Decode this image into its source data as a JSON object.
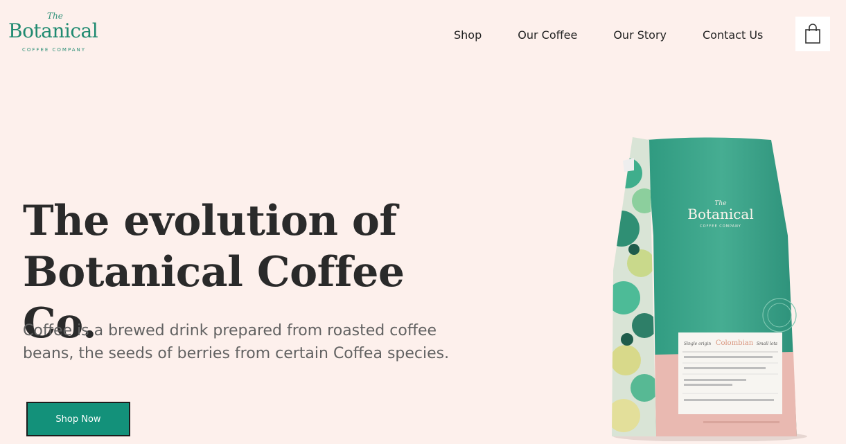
{
  "brand": {
    "the": "The",
    "name": "Botanical",
    "sub": "COFFEE COMPANY"
  },
  "nav": {
    "items": [
      "Shop",
      "Our Coffee",
      "Our Story",
      "Contact Us"
    ]
  },
  "cart": {
    "icon": "shopping-bag-icon"
  },
  "hero": {
    "title_line1": "The evolution of",
    "title_line2": "Botanical Coffee Co.",
    "description": "Coffee is a brewed drink prepared from roasted coffee beans, the seeds of berries from certain Coffea species.",
    "cta_label": "Shop Now"
  },
  "product": {
    "brand_the": "The",
    "brand_name": "Botanical",
    "brand_sub": "COFFEE COMPANY",
    "label_left": "Single origin",
    "label_name": "Colombian",
    "label_right": "Small lots"
  },
  "colors": {
    "background": "#fdf0ec",
    "accent": "#13917a",
    "bag_green": "#3aa58a",
    "bag_pink": "#e9b9b1"
  }
}
